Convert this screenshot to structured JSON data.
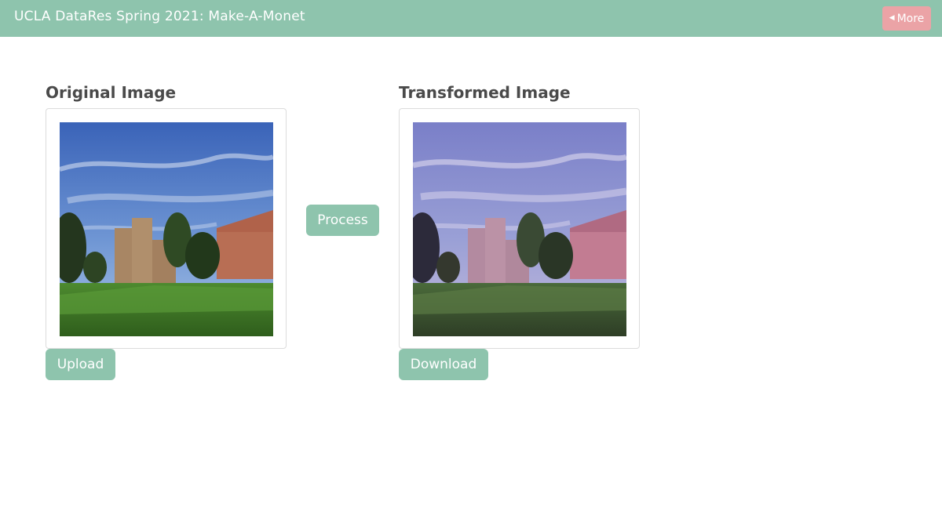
{
  "header": {
    "title": "UCLA DataRes Spring 2021: Make-A-Monet",
    "more_label": "More",
    "more_icon": "caret-left-icon"
  },
  "original": {
    "title": "Original Image",
    "upload_label": "Upload"
  },
  "transformed": {
    "title": "Transformed Image",
    "download_label": "Download"
  },
  "process_label": "Process",
  "colors": {
    "accent": "#8ec4ad",
    "more_button": "#eba3a6",
    "heading_text": "#4a4a4a"
  }
}
